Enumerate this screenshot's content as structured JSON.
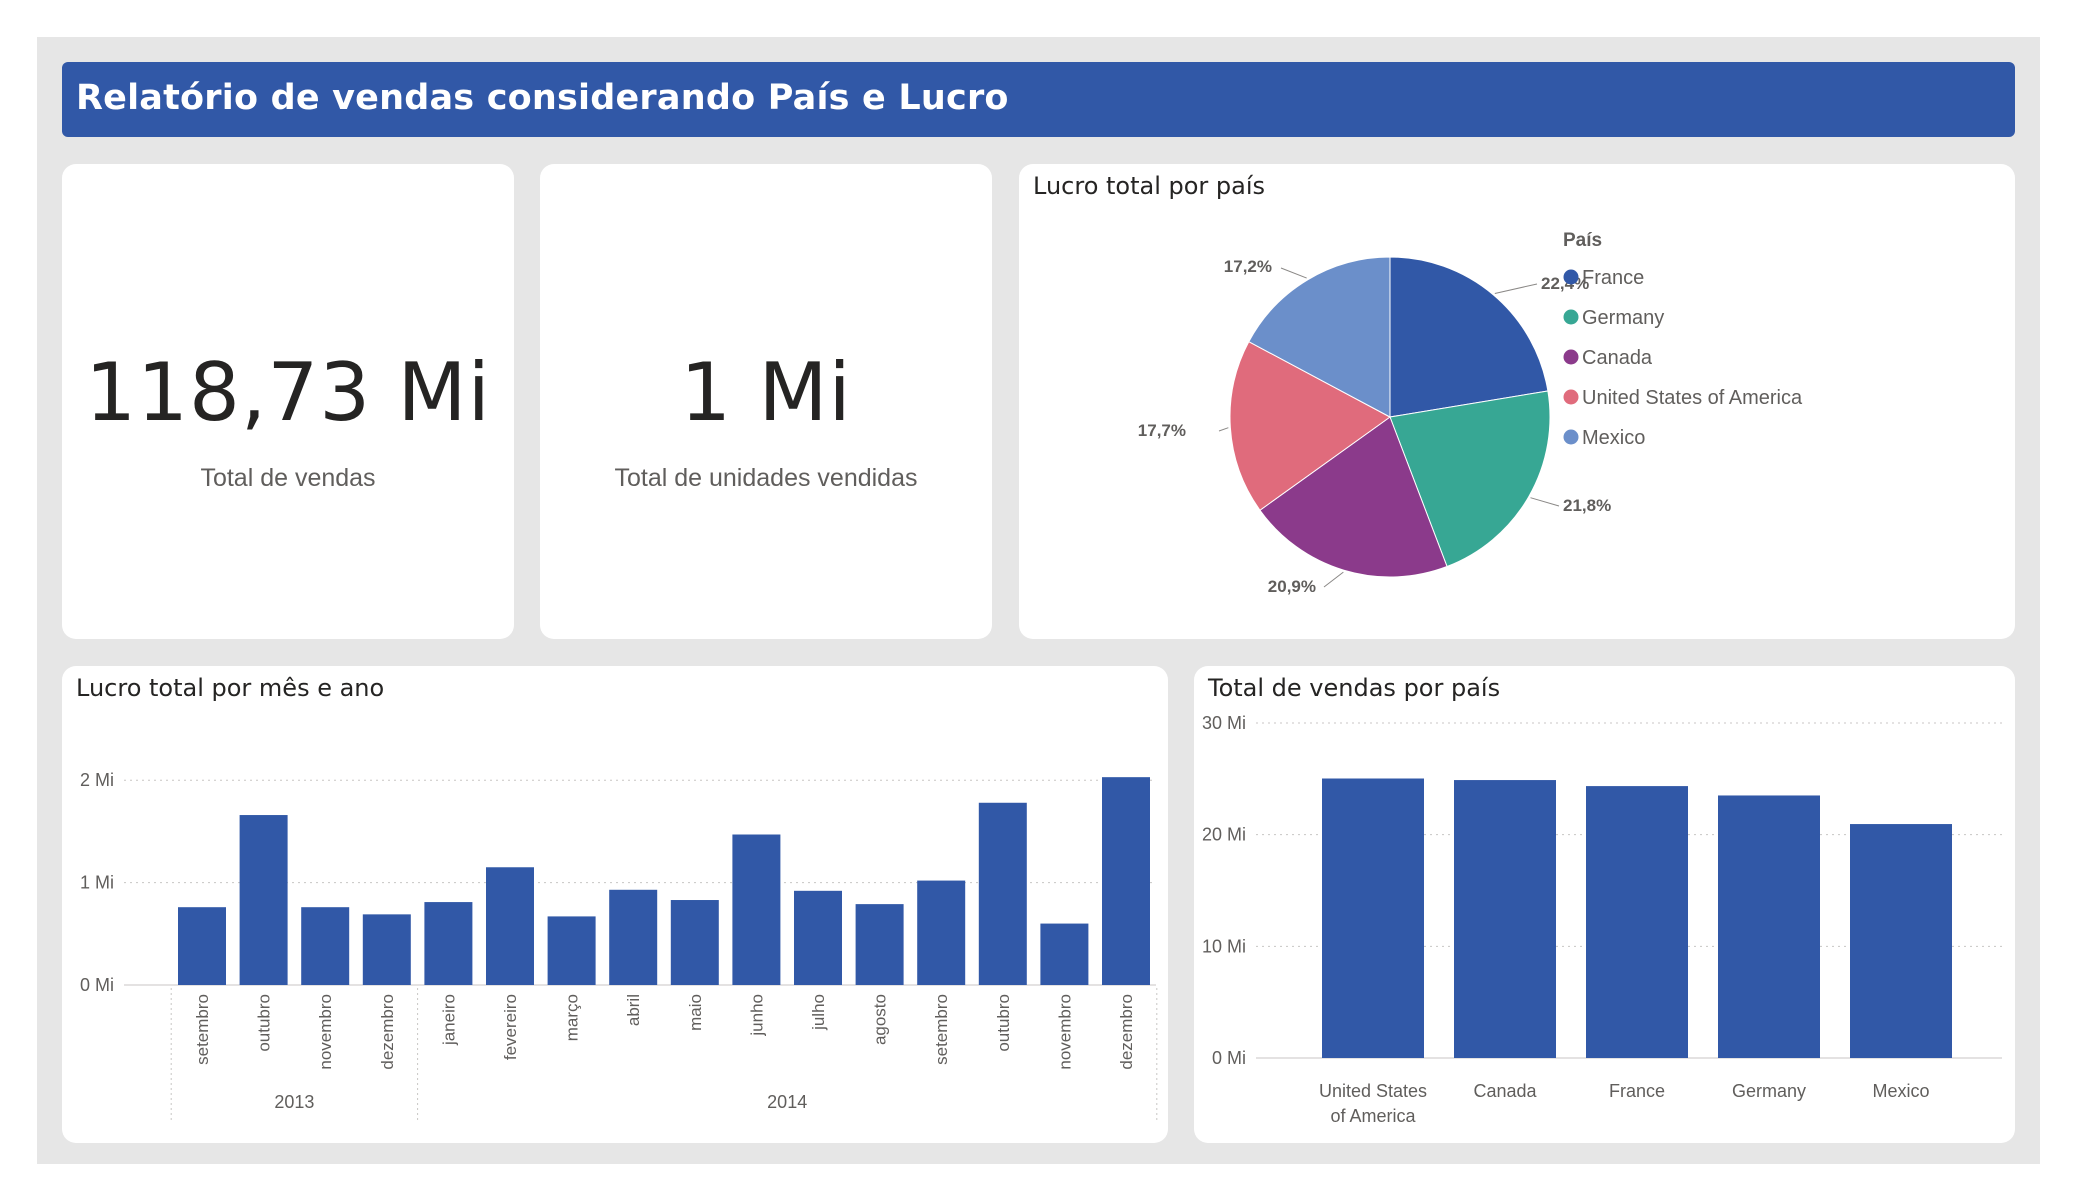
{
  "page": {
    "title": "Relatório de vendas considerando País e Lucro"
  },
  "kpi_sales": {
    "value": "118,73 Mi",
    "label": "Total de vendas"
  },
  "kpi_units": {
    "value": "1 Mi",
    "label": "Total de unidades vendidas"
  },
  "pie_card": {
    "title": "Lucro total por país",
    "legend_title": "País"
  },
  "month_card": {
    "title": "Lucro total por mês e ano"
  },
  "country_card": {
    "title": "Total de vendas por país"
  },
  "colors": {
    "header": "#3158a7",
    "bar": "#3158a7",
    "france": "#3158a7",
    "germany": "#37a794",
    "canada": "#8b3a8b",
    "usa": "#e06b7c",
    "mexico": "#6b8fca"
  },
  "chart_data": [
    {
      "type": "pie",
      "title": "Lucro total por país",
      "legend_title": "País",
      "slices": [
        {
          "name": "France",
          "value": 22.4,
          "label": "22,4%",
          "color": "#3158a7"
        },
        {
          "name": "Germany",
          "value": 21.8,
          "label": "21,8%",
          "color": "#37a794"
        },
        {
          "name": "Canada",
          "value": 20.9,
          "label": "20,9%",
          "color": "#8b3a8b"
        },
        {
          "name": "United States of America",
          "value": 17.7,
          "label": "17,7%",
          "color": "#e06b7c"
        },
        {
          "name": "Mexico",
          "value": 17.2,
          "label": "17,2%",
          "color": "#6b8fca"
        }
      ]
    },
    {
      "type": "bar",
      "title": "Lucro total por mês e ano",
      "categories": [
        "setembro",
        "outubro",
        "novembro",
        "dezembro",
        "janeiro",
        "fevereiro",
        "março",
        "abril",
        "maio",
        "junho",
        "julho",
        "agosto",
        "setembro",
        "outubro",
        "novembro",
        "dezembro"
      ],
      "groups": [
        {
          "label": "2013",
          "count": 4
        },
        {
          "label": "2014",
          "count": 12
        }
      ],
      "values": [
        0.76,
        1.66,
        0.76,
        0.69,
        0.81,
        1.15,
        0.67,
        0.93,
        0.83,
        1.47,
        0.92,
        0.79,
        1.02,
        1.78,
        0.6,
        2.03
      ],
      "ylim": [
        0,
        2.1
      ],
      "yticks": [
        {
          "value": 0,
          "label": "0 Mi"
        },
        {
          "value": 1,
          "label": "1 Mi"
        },
        {
          "value": 2,
          "label": "2 Mi"
        }
      ],
      "grid": true
    },
    {
      "type": "bar",
      "title": "Total de vendas por país",
      "categories": [
        [
          "United States",
          "of America"
        ],
        [
          "Canada"
        ],
        [
          "France"
        ],
        [
          "Germany"
        ],
        [
          "Mexico"
        ]
      ],
      "values": [
        25.03,
        24.89,
        24.35,
        23.51,
        20.95
      ],
      "ylim": [
        0,
        30
      ],
      "yticks": [
        {
          "value": 0,
          "label": "0 Mi"
        },
        {
          "value": 10,
          "label": "10 Mi"
        },
        {
          "value": 20,
          "label": "20 Mi"
        },
        {
          "value": 30,
          "label": "30 Mi"
        }
      ],
      "grid": true
    }
  ]
}
